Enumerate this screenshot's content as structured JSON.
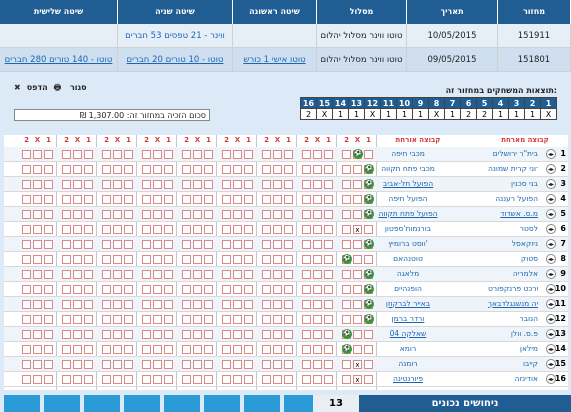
{
  "headers": {
    "round_id": "מחזור",
    "date": "תאריך",
    "route": "מסלול",
    "first_method": "שיטה ראשונה",
    "second_method": "שיטה שניה",
    "third_method": "שיטה שלישית"
  },
  "rows": [
    {
      "round_id": "151911",
      "date": "10/05/2015",
      "route": "טוטו ווינר מסלול יהלום",
      "first_method": "",
      "second_method": "ווינר - 21 טפסים 53 חברים",
      "third_method": ""
    },
    {
      "round_id": "151801",
      "date": "09/05/2015",
      "route": "טוטו ווינר מסלול יהלום",
      "first_method": "טוטו אישי 1 כורש",
      "second_method": "טוטו - 10 טורים 20 חברים",
      "third_method": "טוטו - 140 טורים 280 חברים"
    }
  ],
  "results": {
    "title": "תוצאות המשחקים במחזור זה:",
    "numbers": [
      "16",
      "15",
      "14",
      "13",
      "12",
      "11",
      "10",
      "9",
      "8",
      "7",
      "6",
      "5",
      "4",
      "3",
      "2",
      "1"
    ],
    "values": [
      "2",
      "X",
      "1",
      "1",
      "X",
      "1",
      "1",
      "1",
      "X",
      "1",
      "2",
      "2",
      "1",
      "1",
      "1",
      "X"
    ]
  },
  "actions": {
    "print": "הדפס",
    "close": "סגור"
  },
  "amount_text": "סכום הזכיה במחזור זה: 1,307.00 ₪",
  "grid_header": {
    "home": "קבוצה מארחת",
    "away": "קבוצה אורחת",
    "col1": "1",
    "colx": "X",
    "col2": "2"
  },
  "matches": [
    {
      "n": "1",
      "home": "בית\"ר ירושלים",
      "away": "מכבי חיפה",
      "away_link": false,
      "home_link": false
    },
    {
      "n": "2",
      "home": "עירוני קרית שמונה",
      "away": "מכבי פתח תקווה",
      "away_link": false,
      "home_link": false
    },
    {
      "n": "3",
      "home": "בני סכנין",
      "away": "הפועל תל-אביב",
      "away_link": true,
      "home_link": false
    },
    {
      "n": "4",
      "home": "הפועל רעננה",
      "away": "הפועל חיפה",
      "away_link": false,
      "home_link": false
    },
    {
      "n": "5",
      "home": "מ.ס. אשדוד",
      "away": "הפועל פתח תקווה",
      "away_link": true,
      "home_link": true
    },
    {
      "n": "6",
      "home": "לסטר",
      "away": "בורנמות'ספטון",
      "away_link": false,
      "home_link": false
    },
    {
      "n": "7",
      "home": "ניוקאסל",
      "away": "ווסט ברומיץ'",
      "away_link": false,
      "home_link": false
    },
    {
      "n": "8",
      "home": "סטוק",
      "away": "טוטנהאם",
      "away_link": false,
      "home_link": false
    },
    {
      "n": "9",
      "home": "אלמריה",
      "away": "מלאגה",
      "away_link": false,
      "home_link": false
    },
    {
      "n": "10",
      "home": "איינטרכט פרנקפורט",
      "away": "הופנהיים",
      "away_link": false,
      "home_link": false
    },
    {
      "n": "11",
      "home": "בורוסיה מנשנגלדבאך",
      "away": "באייר לברקוזן",
      "away_link": true,
      "home_link": true
    },
    {
      "n": "12",
      "home": "הנובר",
      "away": "ורדר ברמן",
      "away_link": true,
      "home_link": false
    },
    {
      "n": "13",
      "home": "פ.ס. וולן",
      "away": "שאלקה 04",
      "away_link": true,
      "home_link": false
    },
    {
      "n": "14",
      "home": "מילאן",
      "away": "רומא",
      "away_link": false,
      "home_link": false
    },
    {
      "n": "15",
      "home": "קייבו",
      "away": "רומנה",
      "away_link": false,
      "home_link": false
    },
    {
      "n": "16",
      "home": "אודינזה",
      "away": "פיורנטינה",
      "away_link": true,
      "home_link": false
    }
  ],
  "hits": [
    {
      "result": "x"
    },
    {
      "result": "1"
    },
    {
      "result": "1"
    },
    {
      "result": "1"
    },
    {
      "result": "1"
    },
    {
      "result": "x"
    },
    {
      "result": "1"
    },
    {
      "result": "2"
    },
    {
      "result": "1"
    },
    {
      "result": "1"
    },
    {
      "result": "1"
    },
    {
      "result": "1"
    },
    {
      "result": "2"
    },
    {
      "result": "2"
    },
    {
      "result": "x"
    },
    {
      "result": "x"
    }
  ],
  "footer": {
    "label": "ניחושים נכונים",
    "count": "13"
  },
  "colors": {
    "header_blue": "#1f5d93",
    "accent_green": "#2f9b2f",
    "bet_red": "#d63a3a",
    "footer_cyan": "#2a9bd6"
  }
}
